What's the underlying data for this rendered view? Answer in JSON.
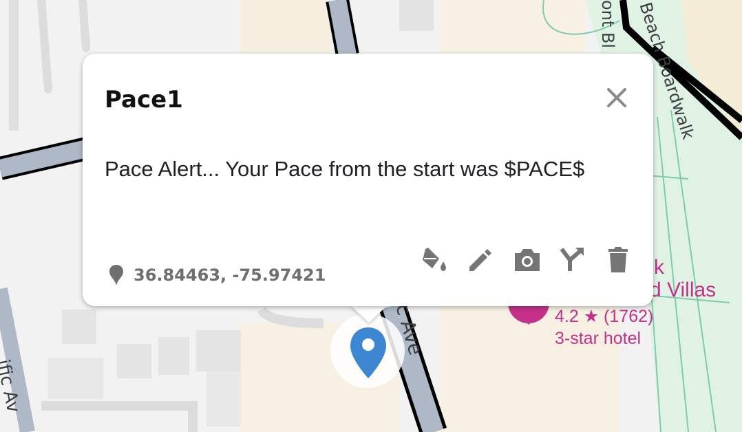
{
  "map": {
    "road_labels": {
      "left_avenue": "ific Av",
      "center_avenue": "c Ave",
      "front_blvd": "ont Bl",
      "boardwalk": "Beach Boardwalk"
    },
    "poi": {
      "name_line1": "k",
      "name_line2": "d Villas",
      "rating": "4.2 ★ (1762)",
      "category": "3-star hotel"
    }
  },
  "popup": {
    "title": "Pace1",
    "message": "Pace Alert... Your Pace from the start was $PACE$",
    "coordinates": "36.84463, -75.97421",
    "actions": [
      "fill-color",
      "edit",
      "photo",
      "directions",
      "delete"
    ]
  },
  "colors": {
    "pin": "#3d86d1",
    "poi_accent": "#c5318a",
    "road_dark": "#000000",
    "road_light": "#aeb8c6"
  }
}
